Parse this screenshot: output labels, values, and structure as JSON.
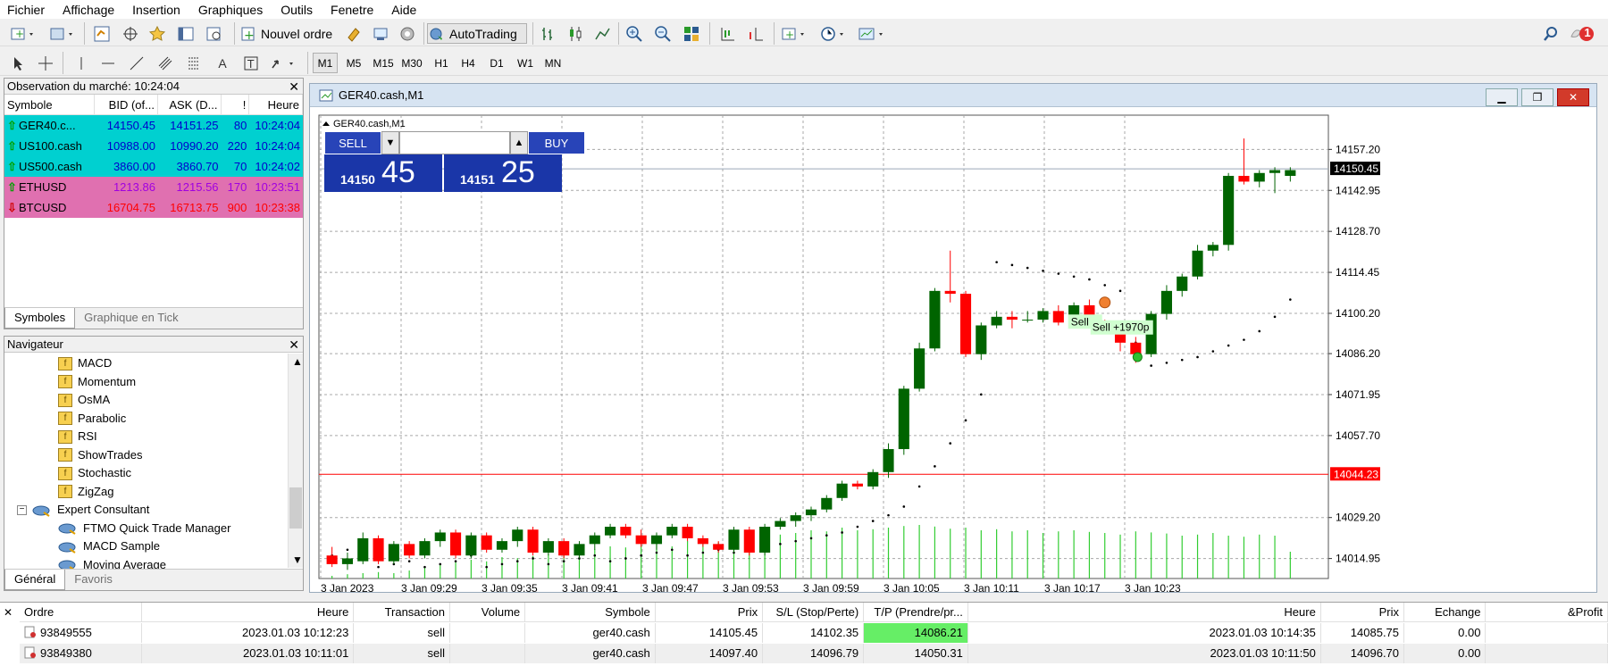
{
  "menu": [
    "Fichier",
    "Affichage",
    "Insertion",
    "Graphiques",
    "Outils",
    "Fenetre",
    "Aide"
  ],
  "toolbar": {
    "new_order_label": "Nouvel ordre",
    "autotrading_label": "AutoTrading",
    "timeframes": [
      "M1",
      "M5",
      "M15",
      "M30",
      "H1",
      "H4",
      "D1",
      "W1",
      "MN"
    ],
    "notification_count": "1"
  },
  "market_watch": {
    "title": "Observation du marché: 10:24:04",
    "headers": [
      "Symbole",
      "BID (of...",
      "ASK (D...",
      "!",
      "Heure"
    ],
    "rows": [
      {
        "symbol": "GER40.c...",
        "bid": "14150.45",
        "ask": "14151.25",
        "spread": "80",
        "time": "10:24:04",
        "dir": "up"
      },
      {
        "symbol": "US100.cash",
        "bid": "10988.00",
        "ask": "10990.20",
        "spread": "220",
        "time": "10:24:04",
        "dir": "up"
      },
      {
        "symbol": "US500.cash",
        "bid": "3860.00",
        "ask": "3860.70",
        "spread": "70",
        "time": "10:24:02",
        "dir": "up"
      },
      {
        "symbol": "ETHUSD",
        "bid": "1213.86",
        "ask": "1215.56",
        "spread": "170",
        "time": "10:23:51",
        "dir": "up"
      },
      {
        "symbol": "BTCUSD",
        "bid": "16704.75",
        "ask": "16713.75",
        "spread": "900",
        "time": "10:23:38",
        "dir": "down"
      }
    ],
    "tabs": [
      "Symboles",
      "Graphique en Tick"
    ]
  },
  "navigator": {
    "title": "Navigateur",
    "indicators": [
      "MACD",
      "Momentum",
      "OsMA",
      "Parabolic",
      "RSI",
      "ShowTrades",
      "Stochastic",
      "ZigZag"
    ],
    "expert_group": "Expert Consultant",
    "experts": [
      "FTMO Quick Trade Manager",
      "MACD Sample",
      "Moving Average"
    ],
    "tabs": [
      "Général",
      "Favoris"
    ]
  },
  "chart": {
    "window_title": "GER40.cash,M1",
    "inner_label": "GER40.cash,M1",
    "sell_label": "SELL",
    "buy_label": "BUY",
    "sell_price_small": "14150",
    "sell_price_big": "45",
    "buy_price_small": "14151",
    "buy_price_big": "25",
    "trade_label": "Sell +1970p",
    "trade_label_short": "Sell",
    "price_ticks": [
      "14157.20",
      "14142.95",
      "14128.70",
      "14114.45",
      "14100.20",
      "14086.20",
      "14071.95",
      "14057.70",
      "14029.20",
      "14014.95"
    ],
    "current_price_label": "14150.45",
    "redline_label": "14044.23",
    "time_ticks": [
      "3 Jan 2023",
      "3 Jan 09:29",
      "3 Jan 09:35",
      "3 Jan 09:41",
      "3 Jan 09:47",
      "3 Jan 09:53",
      "3 Jan 09:59",
      "3 Jan 10:05",
      "3 Jan 10:11",
      "3 Jan 10:17",
      "3 Jan 10:23"
    ],
    "colors": {
      "bull": "#006400",
      "bear": "#ff0000",
      "volume": "#32cd32",
      "sar": "#000000",
      "redline": "#ff0000"
    }
  },
  "chart_data": {
    "type": "candlestick",
    "title": "GER40.cash,M1",
    "ylim": [
      14008,
      14166
    ],
    "candles": [
      {
        "o": 14016,
        "h": 14019,
        "l": 14012,
        "c": 14013
      },
      {
        "o": 14013,
        "h": 14017,
        "l": 14011,
        "c": 14015
      },
      {
        "o": 14014,
        "h": 14024,
        "l": 14013,
        "c": 14022
      },
      {
        "o": 14022,
        "h": 14023,
        "l": 14013,
        "c": 14014
      },
      {
        "o": 14014,
        "h": 14021,
        "l": 14013,
        "c": 14020
      },
      {
        "o": 14020,
        "h": 14021,
        "l": 14015,
        "c": 14016
      },
      {
        "o": 14016,
        "h": 14022,
        "l": 14015,
        "c": 14021
      },
      {
        "o": 14021,
        "h": 14025,
        "l": 14019,
        "c": 14024
      },
      {
        "o": 14024,
        "h": 14025,
        "l": 14015,
        "c": 14016
      },
      {
        "o": 14016,
        "h": 14024,
        "l": 14015,
        "c": 14023
      },
      {
        "o": 14023,
        "h": 14024,
        "l": 14017,
        "c": 14018
      },
      {
        "o": 14018,
        "h": 14022,
        "l": 14017,
        "c": 14021
      },
      {
        "o": 14021,
        "h": 14026,
        "l": 14019,
        "c": 14025
      },
      {
        "o": 14025,
        "h": 14026,
        "l": 14016,
        "c": 14017
      },
      {
        "o": 14017,
        "h": 14022,
        "l": 14016,
        "c": 14021
      },
      {
        "o": 14021,
        "h": 14022,
        "l": 14015,
        "c": 14016
      },
      {
        "o": 14016,
        "h": 14021,
        "l": 14015,
        "c": 14020
      },
      {
        "o": 14020,
        "h": 14024,
        "l": 14018,
        "c": 14023
      },
      {
        "o": 14023,
        "h": 14027,
        "l": 14022,
        "c": 14026
      },
      {
        "o": 14026,
        "h": 14027,
        "l": 14022,
        "c": 14023
      },
      {
        "o": 14023,
        "h": 14025,
        "l": 14019,
        "c": 14020
      },
      {
        "o": 14020,
        "h": 14024,
        "l": 14018,
        "c": 14023
      },
      {
        "o": 14023,
        "h": 14027,
        "l": 14022,
        "c": 14026
      },
      {
        "o": 14026,
        "h": 14027,
        "l": 14021,
        "c": 14022
      },
      {
        "o": 14022,
        "h": 14023,
        "l": 14019,
        "c": 14020
      },
      {
        "o": 14020,
        "h": 14021,
        "l": 14017,
        "c": 14018
      },
      {
        "o": 14018,
        "h": 14026,
        "l": 14017,
        "c": 14025
      },
      {
        "o": 14025,
        "h": 14026,
        "l": 14016,
        "c": 14017
      },
      {
        "o": 14017,
        "h": 14027,
        "l": 14016,
        "c": 14026
      },
      {
        "o": 14026,
        "h": 14029,
        "l": 14025,
        "c": 14028
      },
      {
        "o": 14028,
        "h": 14031,
        "l": 14026,
        "c": 14030
      },
      {
        "o": 14030,
        "h": 14033,
        "l": 14028,
        "c": 14032
      },
      {
        "o": 14032,
        "h": 14037,
        "l": 14031,
        "c": 14036
      },
      {
        "o": 14036,
        "h": 14042,
        "l": 14035,
        "c": 14041
      },
      {
        "o": 14041,
        "h": 14042,
        "l": 14039,
        "c": 14040
      },
      {
        "o": 14040,
        "h": 14046,
        "l": 14039,
        "c": 14045
      },
      {
        "o": 14045,
        "h": 14055,
        "l": 14043,
        "c": 14053
      },
      {
        "o": 14053,
        "h": 14075,
        "l": 14051,
        "c": 14074
      },
      {
        "o": 14074,
        "h": 14090,
        "l": 14073,
        "c": 14088
      },
      {
        "o": 14088,
        "h": 14109,
        "l": 14087,
        "c": 14108
      },
      {
        "o": 14108,
        "h": 14122,
        "l": 14104,
        "c": 14107
      },
      {
        "o": 14107,
        "h": 14108,
        "l": 14085,
        "c": 14086
      },
      {
        "o": 14086,
        "h": 14097,
        "l": 14084,
        "c": 14096
      },
      {
        "o": 14096,
        "h": 14101,
        "l": 14095,
        "c": 14099
      },
      {
        "o": 14099,
        "h": 14101,
        "l": 14095,
        "c": 14098
      },
      {
        "o": 14098,
        "h": 14101,
        "l": 14097,
        "c": 14098
      },
      {
        "o": 14098,
        "h": 14102,
        "l": 14097,
        "c": 14101
      },
      {
        "o": 14101,
        "h": 14103,
        "l": 14096,
        "c": 14097
      },
      {
        "o": 14097,
        "h": 14104,
        "l": 14096,
        "c": 14103
      },
      {
        "o": 14103,
        "h": 14105,
        "l": 14096,
        "c": 14097
      },
      {
        "o": 14097,
        "h": 14098,
        "l": 14093,
        "c": 14095
      },
      {
        "o": 14095,
        "h": 14097,
        "l": 14087,
        "c": 14090
      },
      {
        "o": 14090,
        "h": 14092,
        "l": 14083,
        "c": 14086
      },
      {
        "o": 14086,
        "h": 14101,
        "l": 14085,
        "c": 14100
      },
      {
        "o": 14100,
        "h": 14110,
        "l": 14098,
        "c": 14108
      },
      {
        "o": 14108,
        "h": 14114,
        "l": 14106,
        "c": 14113
      },
      {
        "o": 14113,
        "h": 14124,
        "l": 14112,
        "c": 14122
      },
      {
        "o": 14122,
        "h": 14125,
        "l": 14120,
        "c": 14124
      },
      {
        "o": 14124,
        "h": 14149,
        "l": 14122,
        "c": 14148
      },
      {
        "o": 14148,
        "h": 14161,
        "l": 14145,
        "c": 14146
      },
      {
        "o": 14146,
        "h": 14150,
        "l": 14144,
        "c": 14149
      },
      {
        "o": 14149,
        "h": 14151,
        "l": 14142,
        "c": 14150
      },
      {
        "o": 14148,
        "h": 14151,
        "l": 14146,
        "c": 14150
      }
    ],
    "volume_rel": [
      0.05,
      0.08,
      0.1,
      0.12,
      0.1,
      0.15,
      0.2,
      0.25,
      0.3,
      0.35,
      0.32,
      0.4,
      0.38,
      0.42,
      0.45,
      0.5,
      0.48,
      0.55,
      0.6,
      0.58,
      0.62,
      0.65,
      0.6,
      0.7,
      0.72,
      0.68,
      0.75,
      0.8,
      0.78,
      0.82,
      0.85,
      0.9,
      0.88,
      0.95,
      0.9,
      0.92,
      0.95,
      0.98,
      1.0,
      0.97,
      0.93,
      0.95,
      0.9,
      0.92,
      0.88,
      0.9,
      0.85,
      0.88,
      0.9,
      0.87,
      0.85,
      0.82,
      0.88,
      0.86,
      0.84,
      0.8,
      0.82,
      0.85,
      0.8,
      0.78,
      0.82,
      0.8,
      0.5
    ],
    "sar": [
      14016,
      14018,
      14020,
      14012,
      14013,
      14014,
      14012,
      14013,
      14014,
      14016,
      14012,
      14013,
      14014,
      14015,
      14013,
      14014,
      14015,
      14016,
      14014,
      14015,
      14016,
      14017,
      14018,
      14016,
      14017,
      14018,
      14017,
      14018,
      14019,
      14020,
      14021,
      14022,
      14023,
      14024,
      14026,
      14028,
      14030,
      14033,
      14040,
      14047,
      14055,
      14063,
      14072,
      14118,
      14117,
      14116,
      14115,
      14114,
      14113,
      14112,
      14110,
      14108,
      14090,
      14082,
      14083,
      14084,
      14085,
      14087,
      14089,
      14091,
      14094,
      14099,
      14105
    ],
    "trade_levels": {
      "current": 14150.45,
      "red_line": 14044.23
    }
  },
  "terminal": {
    "headers": [
      "Ordre",
      "Heure",
      "Transaction",
      "Volume",
      "Symbole",
      "Prix",
      "S/L (Stop/Perte)",
      "T/P (Prendre/pr...",
      "Heure",
      "Prix",
      "Echange",
      "&Profit"
    ],
    "rows": [
      {
        "order": "93849555",
        "time": "2023.01.03 10:12:23",
        "type": "sell",
        "volume": "",
        "symbol": "ger40.cash",
        "price": "14105.45",
        "sl": "14102.35",
        "tp": "14086.21",
        "close_time": "2023.01.03 10:14:35",
        "close_price": "14085.75",
        "swap": "0.00",
        "profit": ""
      },
      {
        "order": "93849380",
        "time": "2023.01.03 10:11:01",
        "type": "sell",
        "volume": "",
        "symbol": "ger40.cash",
        "price": "14097.40",
        "sl": "14096.79",
        "tp": "14050.31",
        "close_time": "2023.01.03 10:11:50",
        "close_price": "14096.70",
        "swap": "0.00",
        "profit": ""
      }
    ],
    "tp_highlight": "#66ee66"
  }
}
